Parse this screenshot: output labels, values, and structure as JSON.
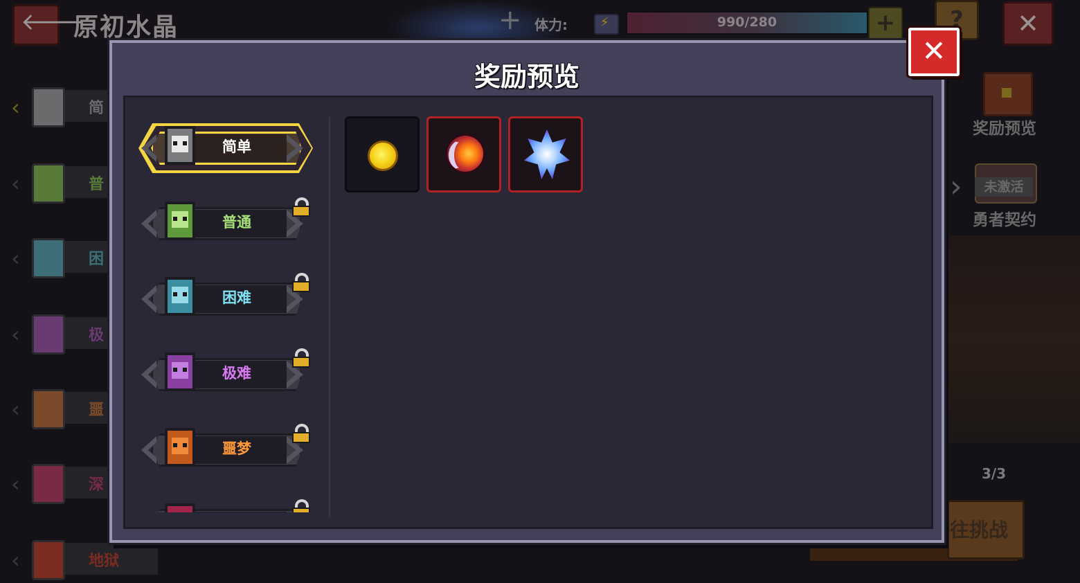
{
  "background": {
    "header": {
      "back_icon": "arrow-left-icon",
      "title": "原初水晶",
      "stamina_label": "体力:",
      "stamina_value": "990/280",
      "stamina_add_icon": "plus-icon",
      "help_icon": "question-icon",
      "close_icon": "close-icon"
    },
    "tabs": [
      {
        "label": "简",
        "color": "#6b6a6c"
      },
      {
        "label": "普",
        "color": "#5a7a3a"
      },
      {
        "label": "困",
        "color": "#3d6e78"
      },
      {
        "label": "极",
        "color": "#6a3a72"
      },
      {
        "label": "噩",
        "color": "#7a4a2a"
      },
      {
        "label": "深",
        "color": "#7a2a45"
      },
      {
        "label": "地狱",
        "color": "#7a2c20"
      }
    ],
    "right_panel": {
      "reward_preview_label": "奖励预览",
      "contract_status": "未激活",
      "contract_label": "勇者契约",
      "page_count": "3/3",
      "challenge_label": "往挑战"
    }
  },
  "modal": {
    "title": "奖励预览",
    "close_icon": "close-icon",
    "difficulties": [
      {
        "label": "简单",
        "color": "#ffffff",
        "icon_color": "#7c7b7d",
        "face_color": "#e9e9e9",
        "locked": false,
        "active": true
      },
      {
        "label": "普通",
        "color": "#a7e07a",
        "icon_color": "#5f9a3a",
        "face_color": "#b8e48b",
        "locked": true,
        "active": false
      },
      {
        "label": "困难",
        "color": "#7fe0f2",
        "icon_color": "#3b8fa0",
        "face_color": "#97dbe8",
        "locked": true,
        "active": false
      },
      {
        "label": "极难",
        "color": "#d87bf2",
        "icon_color": "#8a3fa3",
        "face_color": "#c27fe0",
        "locked": true,
        "active": false
      },
      {
        "label": "噩梦",
        "color": "#ff9a3a",
        "icon_color": "#c25a1e",
        "face_color": "#f08a3a",
        "locked": true,
        "active": false
      },
      {
        "label": "",
        "color": "#ff5a8a",
        "icon_color": "#a3244a",
        "face_color": "#e04a7a",
        "locked": true,
        "active": false
      }
    ],
    "rewards": [
      {
        "name": "gold-coin-icon",
        "rarity": "common"
      },
      {
        "name": "sun-moon-emblem-icon",
        "rarity": "rare"
      },
      {
        "name": "blue-crystal-icon",
        "rarity": "rare"
      }
    ]
  }
}
